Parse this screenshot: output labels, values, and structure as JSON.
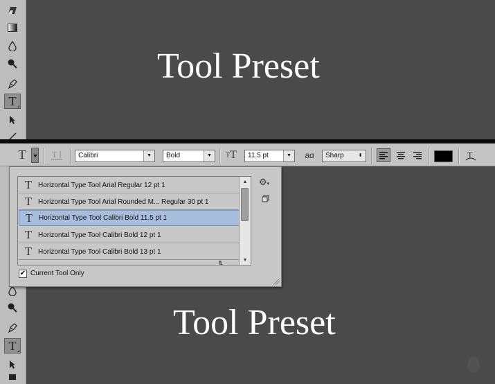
{
  "top_title": "Tool Preset",
  "bottom_title": "Tool Preset",
  "options_bar": {
    "font_family": "Calibri",
    "font_style": "Bold",
    "font_size": "11.5 pt",
    "aa_label": "aɑ",
    "anti_alias": "Sharp",
    "text_color": "#000000"
  },
  "preset_picker": {
    "items": [
      {
        "label": "Horizontal Type Tool Arial Regular 12 pt 1"
      },
      {
        "label": "Horizontal Type Tool Arial Rounded M... Regular 30 pt 1"
      },
      {
        "label": "Horizontal Type Tool Calibri Bold 11.5 pt 1",
        "selected": true
      },
      {
        "label": "Horizontal Type Tool Calibri Bold 12 pt 1"
      },
      {
        "label": "Horizontal Type Tool Calibri Bold 13 pt 1"
      }
    ],
    "current_tool_only": "Current Tool Only",
    "current_tool_only_checked": true
  },
  "colors": {
    "canvas": "#4a4a4a",
    "toolbar": "#c4c4c4",
    "selection": "#a9bedd"
  }
}
